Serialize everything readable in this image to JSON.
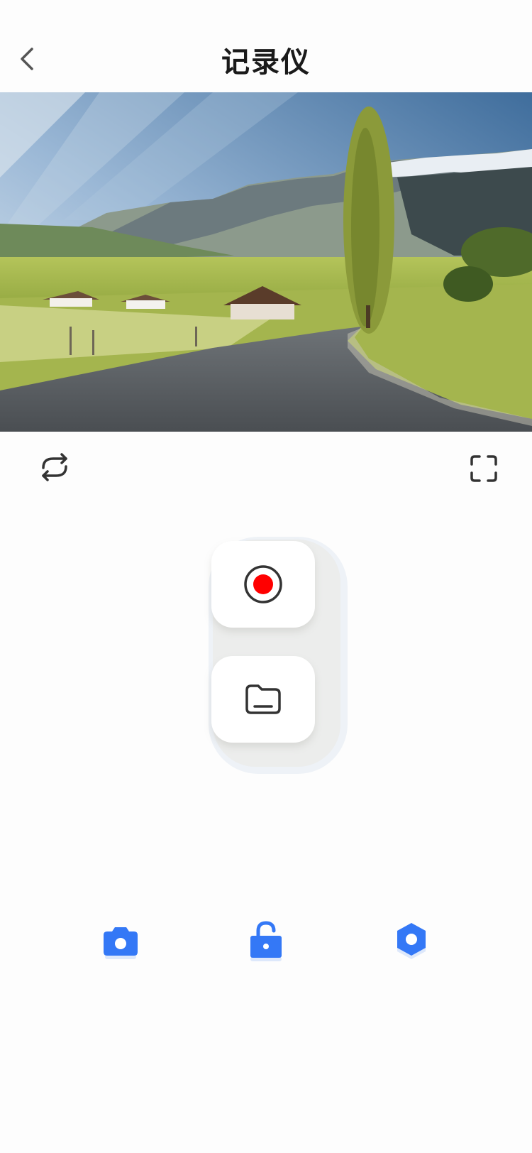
{
  "header": {
    "title": "记录仪"
  },
  "icons": {
    "back": "chevron-left-icon",
    "loop": "loop-icon",
    "fullscreen": "fullscreen-icon",
    "record": "record-icon",
    "files": "folder-icon",
    "camera": "camera-icon",
    "lock": "unlock-icon",
    "settings": "hexagon-settings-icon"
  },
  "colors": {
    "accent_blue": "#3478f6",
    "record_red": "#ff0000",
    "icon_dark": "#333333"
  }
}
